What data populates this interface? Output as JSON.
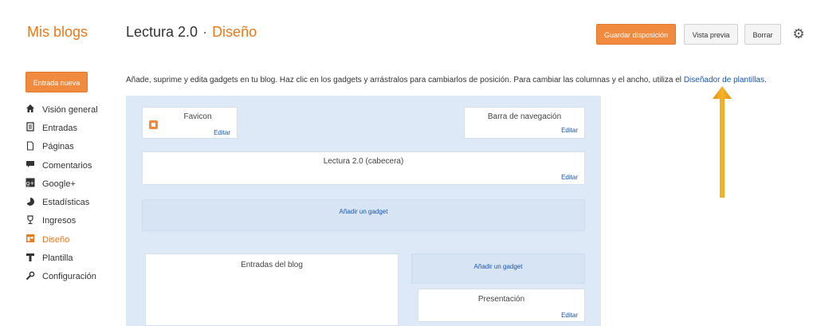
{
  "header": {
    "logo": "Mis blogs",
    "blog_name": "Lectura 2.0",
    "separator": "·",
    "section": "Diseño",
    "save_label": "Guardar disposición",
    "preview_label": "Vista previa",
    "delete_label": "Borrar",
    "settings_icon": "gear-icon"
  },
  "sidebar": {
    "new_post_label": "Entrada nueva",
    "items": [
      {
        "label": "Visión general",
        "icon": "home-icon"
      },
      {
        "label": "Entradas",
        "icon": "posts-icon"
      },
      {
        "label": "Páginas",
        "icon": "page-icon"
      },
      {
        "label": "Comentarios",
        "icon": "comment-icon"
      },
      {
        "label": "Google+",
        "icon": "google-plus-icon"
      },
      {
        "label": "Estadísticas",
        "icon": "stats-icon"
      },
      {
        "label": "Ingresos",
        "icon": "trophy-icon"
      },
      {
        "label": "Diseño",
        "icon": "layout-icon"
      },
      {
        "label": "Plantilla",
        "icon": "template-icon"
      },
      {
        "label": "Configuración",
        "icon": "wrench-icon"
      }
    ]
  },
  "main": {
    "instructions": "Añade, suprime y edita gadgets en tu blog. Haz clic en los gadgets y arrástralos para cambiarlos de posición. Para cambiar las columnas y el ancho, utiliza el ",
    "instructions_link": "Diseñador de plantillas",
    "instructions_end": ".",
    "gadgets": {
      "favicon": {
        "name": "Favicon",
        "edit": "Editar"
      },
      "navbar": {
        "name": "Barra de navegación",
        "edit": "Editar"
      },
      "header": {
        "name": "Lectura 2.0 (cabecera)",
        "edit": "Editar"
      },
      "add_gadget_top": "Añadir un gadget",
      "blog_posts": {
        "name": "Entradas del blog"
      },
      "add_gadget_side": "Añadir un gadget",
      "presentation": {
        "name": "Presentación",
        "edit": "Editar"
      }
    }
  },
  "colors": {
    "accent": "#e9791b",
    "button_orange": "#f08a3e",
    "link": "#1a55b5",
    "panel_bg": "#dde9f7",
    "arrow": "#f2a20c"
  }
}
